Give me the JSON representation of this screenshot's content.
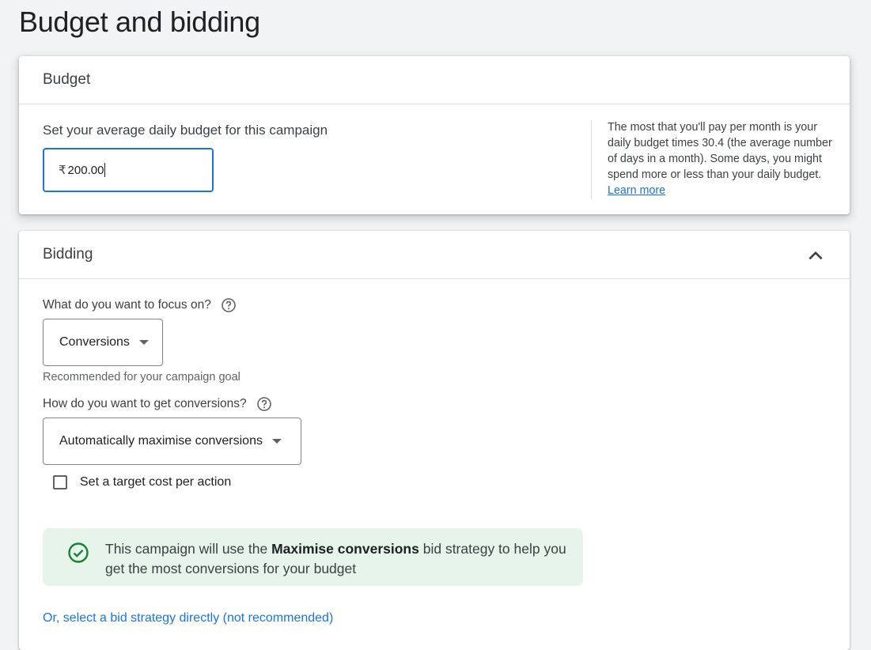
{
  "page_title": "Budget and bidding",
  "budget": {
    "title": "Budget",
    "label": "Set your average daily budget for this campaign",
    "currency_symbol": "₹",
    "value": "200.00",
    "help_text": "The most that you'll pay per month is your daily budget times 30.4 (the average number of days in a month). Some days, you might spend more or less than your daily budget.",
    "learn_more": "Learn more"
  },
  "bidding": {
    "title": "Bidding",
    "collapse_icon": "chevron-up-icon",
    "focus_question": "What do you want to focus on?",
    "focus_value": "Conversions",
    "focus_hint": "Recommended for your campaign goal",
    "conversions_question": "How do you want to get conversions?",
    "conversions_value": "Automatically maximise conversions",
    "target_cpa_label": "Set a target cost per action",
    "target_cpa_checked": false,
    "info_prefix": "This campaign will use the",
    "info_strategy": "Maximise conversions",
    "info_suffix": "bid strategy to help you get the most conversions for your budget",
    "select_strategy_link": "Or, select a bid strategy directly (not recommended)"
  },
  "colors": {
    "accent": "#1a73e8",
    "success": "#188038",
    "banner_bg": "#e6f4ea"
  }
}
